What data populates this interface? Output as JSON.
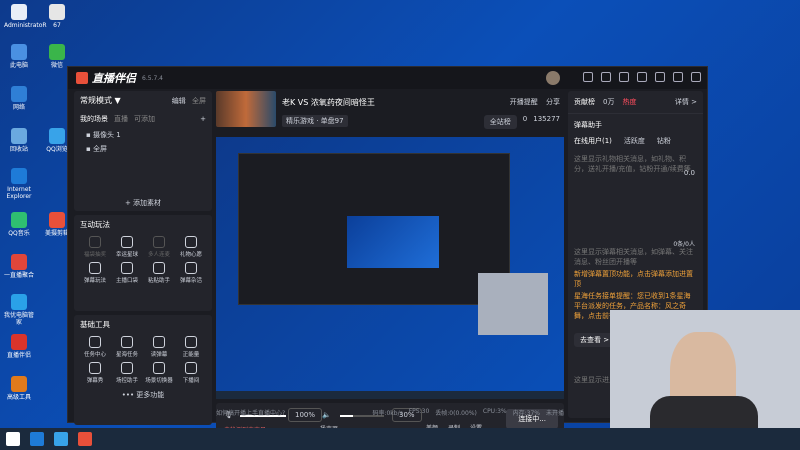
{
  "desktop": {
    "icons": [
      {
        "label": "AdministratoR",
        "color": "#e8eef7"
      },
      {
        "label": "此电脑",
        "color": "#4a90e2"
      },
      {
        "label": "网络",
        "color": "#2f7fd6"
      },
      {
        "label": "回收站",
        "color": "#6aa9e0"
      },
      {
        "label": "Internet Explorer",
        "color": "#1e7bd8"
      },
      {
        "label": "QQ音乐",
        "color": "#2fbf71"
      },
      {
        "label": "一直播聚合",
        "color": "#e0463a"
      },
      {
        "label": "我优电脑管家",
        "color": "#2aa1e8"
      },
      {
        "label": "直播伴侣",
        "color": "#d9342b"
      },
      {
        "label": "高级工具",
        "color": "#e07a1c"
      },
      {
        "label": "微信",
        "color": "#3ab54a"
      },
      {
        "label": "QQ浏览",
        "color": "#38a3e9"
      },
      {
        "label": "美摄剪辑",
        "color": "#e8503a"
      },
      {
        "label": "67",
        "color": "#e6e6e6"
      }
    ]
  },
  "app": {
    "name": "直播伴侣",
    "version": "6.5.7.4",
    "left": {
      "mode": "常规模式 ▼",
      "edit": "编辑",
      "all": "全屏",
      "scene_tabs": [
        "我的场景",
        "直播",
        "可添加"
      ],
      "sources": [
        "摄像头 1",
        "全屏"
      ],
      "add_source": "+ 添加素材",
      "interactive_title": "互动玩法",
      "interactive": [
        {
          "label": "福袋抽奖",
          "dim": true
        },
        {
          "label": "幸运星球",
          "dim": false
        },
        {
          "label": "多人连麦",
          "dim": true
        },
        {
          "label": "礼物心愿",
          "dim": false
        },
        {
          "label": "弹幕玩法",
          "dim": false
        },
        {
          "label": "主播口袋",
          "dim": false
        },
        {
          "label": "粘贴助手",
          "dim": false
        },
        {
          "label": "弹幕杂活",
          "dim": false
        }
      ],
      "basic_title": "基础工具",
      "basic": [
        {
          "label": "任务中心",
          "dim": false
        },
        {
          "label": "星海任务",
          "dim": false
        },
        {
          "label": "读弹幕",
          "dim": false
        },
        {
          "label": "正能量",
          "dim": false
        },
        {
          "label": "弹幕秀",
          "dim": false
        },
        {
          "label": "场控助手",
          "dim": false
        },
        {
          "label": "场景切换器",
          "dim": false
        },
        {
          "label": "下播间",
          "dim": false
        }
      ],
      "more": "••• 更多功能"
    },
    "center": {
      "title": "老K VS 浓氧药夜间暗怪王",
      "sub": "精乐游戏 · 单盘97",
      "badge": "全站榜",
      "like": "0",
      "fans": "135277",
      "open_reminder": "开播提醒",
      "share": "分享",
      "mic_label": "100%",
      "mic_text": "麦克风",
      "speaker_label": "30%",
      "speaker_text": "扬声器",
      "beauty": "美颜",
      "record": "录制",
      "settings": "设置",
      "connect_button": "连接中...",
      "warn": "未检测到麦克风",
      "status_items": [
        "码率:0kb/s",
        "FPS:30",
        "丢帧:0(0.00%)",
        "CPU:3%",
        "内存:37%",
        "未开播"
      ],
      "help": "如何搞开播上手直播中心?"
    },
    "right": {
      "tab_contrib": "贡献榜",
      "tab_hot": "0万",
      "tab_hot_label": "热度",
      "detail": "详情 >",
      "danmu_title": "弹幕助手",
      "online_users": "在线用户(1)",
      "fans_group": "活跃度",
      "pin": "钻粉",
      "msg1": "这里显示礼物相关消息，如礼物、积分，送礼开播/充值，钻粉开通/续费等",
      "gift_count": "0.0",
      "gift_sub": "总",
      "counter": "0条/0人",
      "msg2": "这里显示弹幕相关消息，如弹幕、关注消息、粉丝团开播等",
      "notice1": "新增弹幕置顶功能，点击弹幕添加进置顶",
      "notice2": "星海任务接单提醒：您已收到1条星海平台派发的任务，产品名称：风之奇舞，点击前往星海查看任务详情吧。",
      "goto": "去查看 >",
      "msg3": "这里显示进入直播间观众",
      "colors": {
        "accent": "#ff4d5e",
        "notice": "#f0a23a"
      }
    }
  }
}
